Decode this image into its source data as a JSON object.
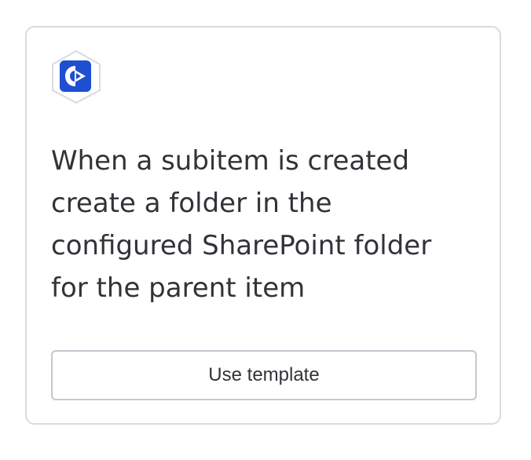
{
  "card": {
    "app_icon": "sharepoint-app-icon",
    "description": "When a subitem is created create a folder in the configured SharePoint folder for the parent item",
    "button_label": "Use template"
  },
  "colors": {
    "icon_blue": "#1e4fd1",
    "card_border": "#d9dae3",
    "text": "#323338",
    "button_border": "#c5c7d0"
  }
}
